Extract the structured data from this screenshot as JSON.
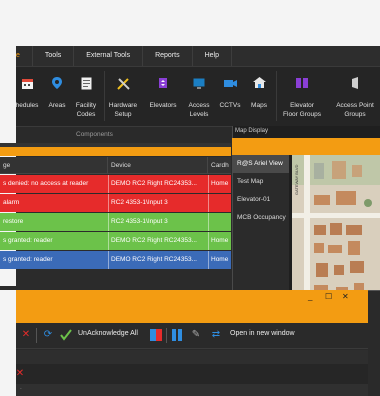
{
  "menu": {
    "items": [
      "e",
      "Tools",
      "External Tools",
      "Reports",
      "Help"
    ]
  },
  "ribbon": {
    "buttons": [
      {
        "label": "hedules",
        "icon": "calendar-icon"
      },
      {
        "label": "Areas",
        "icon": "location-pin-icon"
      },
      {
        "label": "Facility\nCodes",
        "icon": "document-icon"
      },
      {
        "label": "Hardware\nSetup",
        "icon": "tools-icon"
      },
      {
        "label": "Elevators",
        "icon": "elevator-icon"
      },
      {
        "label": "Access\nLevels",
        "icon": "monitor-icon"
      },
      {
        "label": "CCTVs",
        "icon": "camera-icon"
      },
      {
        "label": "Maps",
        "icon": "map-icon"
      },
      {
        "label": "Elevator\nFloor Groups",
        "icon": "elevator-group-icon"
      },
      {
        "label": "Access Point\nGroups",
        "icon": "access-point-icon"
      }
    ],
    "group_label": "Components"
  },
  "grid": {
    "columns": [
      "ge",
      "Device",
      "Cardh"
    ],
    "rows": [
      {
        "message": "s denied: no access at reader",
        "device": "DEMO RC2 Right RC24353...",
        "card": "Home",
        "status": "red"
      },
      {
        "message": "alarm",
        "device": "RC2 4353-1\\Input 3",
        "card": "",
        "status": "red"
      },
      {
        "message": "restore",
        "device": "RC2 4353-1\\Input 3",
        "card": "",
        "status": "green"
      },
      {
        "message": "s granted: reader",
        "device": "DEMO RC2 Right RC24353...",
        "card": "Home",
        "status": "green"
      },
      {
        "message": "s granted: reader",
        "device": "DEMO RC2 Right RC24353...",
        "card": "Home",
        "status": "blue"
      }
    ]
  },
  "map_display": {
    "title": "Map Display",
    "items": [
      "R@S Ariel View",
      "Test Map",
      "Elevator-01",
      "MCB Occupancy"
    ],
    "selected_index": 0,
    "street_label_1": "GATEWAY BLVD",
    "street_label_2": "SS AVE."
  },
  "float_window": {
    "controls": {
      "minimize": "_",
      "maximize": "☐",
      "close": "✕"
    },
    "toolbar": {
      "unack_label": "UnAcknowledge All",
      "open_new_label": "Open in new window"
    }
  },
  "colors": {
    "accent": "#f39c12",
    "row_red": "#e62b2b",
    "row_green": "#6cc24a",
    "row_blue": "#3b6bb8"
  }
}
